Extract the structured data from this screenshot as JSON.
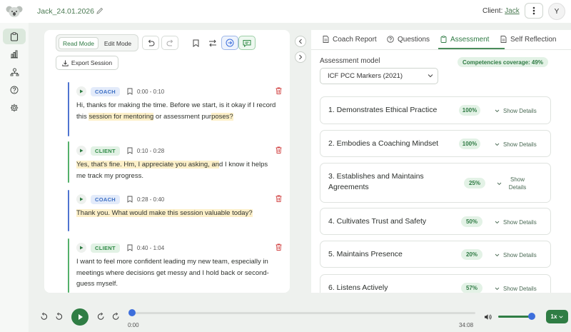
{
  "header": {
    "session_title": "Jack_24.01.2026",
    "client_prefix": "Client:",
    "client_name": "Jack",
    "avatar_initial": "Y"
  },
  "toolbar": {
    "read_mode": "Read Mode",
    "edit_mode": "Edit Mode",
    "export_label": "Export Session"
  },
  "transcript": [
    {
      "speaker": "COACH",
      "time": "0:00 - 0:10",
      "parts": [
        {
          "t": "Hi, thanks for making the time. Before we start, is it okay if I record this ",
          "hl": false
        },
        {
          "t": " session for mentoring",
          "hl": true
        },
        {
          "t": " or assessment pur",
          "hl": false
        },
        {
          "t": "poses?",
          "hl": true
        }
      ]
    },
    {
      "speaker": "CLIENT",
      "time": "0:10 - 0:28",
      "parts": [
        {
          "t": "Yes, that's fine. Hm, I appreciate you asking, an",
          "hl": true
        },
        {
          "t": "d I know it helps me track my progress.",
          "hl": false
        }
      ]
    },
    {
      "speaker": "COACH",
      "time": "0:28 - 0:40",
      "parts": [
        {
          "t": "Thank you. What would make this session valuable today?",
          "hl": true
        }
      ]
    },
    {
      "speaker": "CLIENT",
      "time": "0:40 - 1:04",
      "parts": [
        {
          "t": "I want to feel more confident leading my new team, especially in meetings where decisions get messy and I hold back or second-guess myself.",
          "hl": false
        }
      ]
    }
  ],
  "tabs": [
    {
      "label": "Coach Report",
      "icon": "document-icon"
    },
    {
      "label": "Questions",
      "icon": "question-icon"
    },
    {
      "label": "Assessment",
      "icon": "clipboard-icon"
    },
    {
      "label": "Self Reflection",
      "icon": "document-icon"
    }
  ],
  "assessment": {
    "model_label": "Assessment model",
    "coverage": "Competencies coverage: 49%",
    "model_value": "ICF PCC Markers (2021)",
    "competencies": [
      {
        "title": "1. Demonstrates Ethical Practice",
        "pct": "100%",
        "details": "Show Details"
      },
      {
        "title": "2. Embodies a Coaching Mindset",
        "pct": "100%",
        "details": "Show Details"
      },
      {
        "title": "3. Establishes and Maintains Agreements",
        "pct": "25%",
        "details": "Show Details"
      },
      {
        "title": "4. Cultivates Trust and Safety",
        "pct": "50%",
        "details": "Show Details"
      },
      {
        "title": "5. Maintains Presence",
        "pct": "20%",
        "details": "Show Details"
      },
      {
        "title": "6. Listens Actively",
        "pct": "57%",
        "details": "Show Details"
      }
    ]
  },
  "player": {
    "current_time": "0:00",
    "duration": "34:08",
    "progress": 0,
    "volume": 1.0,
    "speed": "1x"
  },
  "colors": {
    "brand_green": "#2f7d44",
    "coach_blue": "#3d6fc4",
    "client_green": "#2e8a45",
    "highlight": "#fdf0c9"
  }
}
